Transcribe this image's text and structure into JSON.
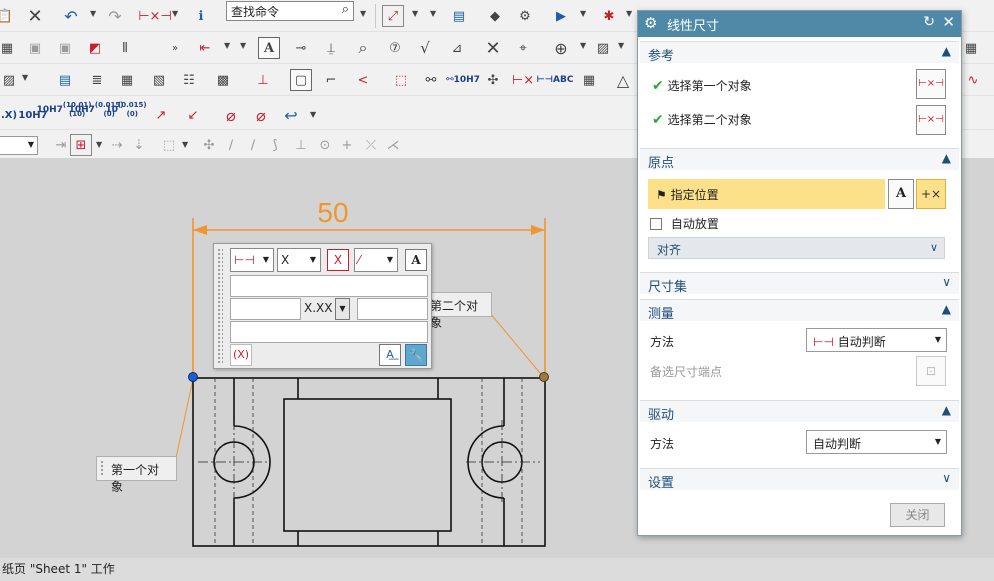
{
  "toolbar": {
    "search_placeholder": "查找命令",
    "tol_10h7": "10H7",
    "tol_10h7_a_top": "10H7",
    "tol_10h7_a_bot": "(10.01) (10)",
    "tol_10h7_b_top": "10H7",
    "tol_10h7_b_bot": "(0.015) (0)",
    "tol_10_top": "10",
    "tol_10_bot": "(0.015) (0)",
    "tol_x": ".X)",
    "tol_10h7_small": "10H7",
    "abc_label": "ABC",
    "text_a": "A"
  },
  "drawing": {
    "dimension_value": "50",
    "first_object_label": "第一个对象",
    "second_object_label": "第二个对象",
    "colors": {
      "dimension": "#f0962e",
      "geometry": "#111111",
      "point1": "#1e5fd0",
      "point2": "#9a7a40"
    }
  },
  "float_toolbar": {
    "axis_value": "X",
    "format_value": "X.XX",
    "text_a": "A",
    "paren_x": "(X)",
    "x_box": "X"
  },
  "status": {
    "text": "纸页 \"Sheet 1\" 工作"
  },
  "dialog": {
    "title": "线性尺寸",
    "sections": {
      "reference": "参考",
      "origin": "原点",
      "dimension_set": "尺寸集",
      "measure": "测量",
      "drive": "驱动",
      "settings": "设置"
    },
    "reference": {
      "select_first": "选择第一个对象",
      "select_second": "选择第二个对象"
    },
    "origin": {
      "specify_location": "指定位置",
      "auto_place": "自动放置",
      "align": "对齐"
    },
    "measure": {
      "method_label": "方法",
      "method_value": "自动判断",
      "alt_endpoint": "备选尺寸端点"
    },
    "drive": {
      "method_label": "方法",
      "method_value": "自动判断"
    },
    "close_button": "关闭",
    "colors": {
      "title_bar": "#4e8aa8",
      "section_text": "#1f4e79",
      "highlight": "#fde08a",
      "check": "#2fa53a"
    }
  }
}
